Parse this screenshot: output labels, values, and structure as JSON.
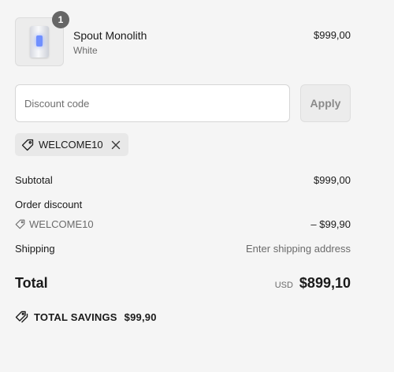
{
  "product": {
    "quantity": "1",
    "name": "Spout Monolith",
    "variant": "White",
    "price": "$999,00",
    "image_icon": "product-device-image"
  },
  "discount": {
    "placeholder": "Discount code",
    "value": "",
    "apply_label": "Apply",
    "applied_code": "WELCOME10"
  },
  "summary": {
    "subtotal_label": "Subtotal",
    "subtotal_value": "$999,00",
    "order_discount_label": "Order discount",
    "discount_code": "WELCOME10",
    "discount_value": "– $99,90",
    "shipping_label": "Shipping",
    "shipping_value": "Enter shipping address",
    "total_label": "Total",
    "currency": "USD",
    "total_value": "$899,10",
    "savings_label": "TOTAL SAVINGS",
    "savings_value": "$99,90"
  },
  "colors": {
    "background": "#f5f5f5",
    "text": "#1a1a1a",
    "muted": "#6b6b6b",
    "badge": "#666666"
  }
}
